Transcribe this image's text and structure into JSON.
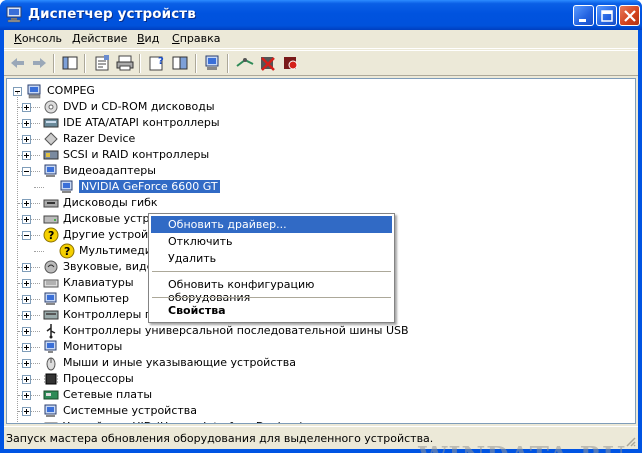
{
  "window": {
    "title": "Диспетчер устройств"
  },
  "menu": {
    "items": [
      {
        "label": "Консоль",
        "accel": "К"
      },
      {
        "label": "Действие",
        "accel": "Д"
      },
      {
        "label": "Вид",
        "accel": "В"
      },
      {
        "label": "Справка",
        "accel": "С"
      }
    ]
  },
  "toolbar": {
    "buttons": [
      "back-icon",
      "forward-icon",
      "show-hide-tree-icon",
      "properties-icon",
      "print-icon",
      "help-icon",
      "view-icon",
      "update-driver-icon",
      "scan-hardware-icon",
      "uninstall-icon",
      "disable-icon"
    ]
  },
  "tree": {
    "root": "COMPEG",
    "items": [
      "DVD и CD-ROM дисководы",
      "IDE ATA/ATAPI контроллеры",
      "Razer Device",
      "SCSI и RAID контроллеры",
      "Видеоадаптеры",
      "NVIDIA GeForce 6600 GT",
      "Дисководы гибк",
      "Дисковые устр",
      "Другие устройс",
      "Мультимеди",
      "Звуковые, виде",
      "Клавиатуры",
      "Компьютер",
      "Контроллеры гибких дисков",
      "Контроллеры универсальной последовательной шины USB",
      "Мониторы",
      "Мыши и иные указывающие устройства",
      "Процессоры",
      "Сетевые платы",
      "Системные устройства",
      "Устройства HID (Human Interface Devices)"
    ]
  },
  "context_menu": {
    "items": [
      {
        "label": "Обновить драйвер..."
      },
      {
        "label": "Отключить"
      },
      {
        "label": "Удалить"
      },
      {
        "label": "Обновить конфигурацию оборудования"
      },
      {
        "label": "Свойства"
      }
    ]
  },
  "status": {
    "text": "Запуск мастера обновления оборудования для выделенного устройства."
  },
  "watermark": "WINDATA.RU",
  "colors": {
    "title_blue": "#0054e3",
    "selection": "#316ac5",
    "face": "#ece9d8"
  }
}
